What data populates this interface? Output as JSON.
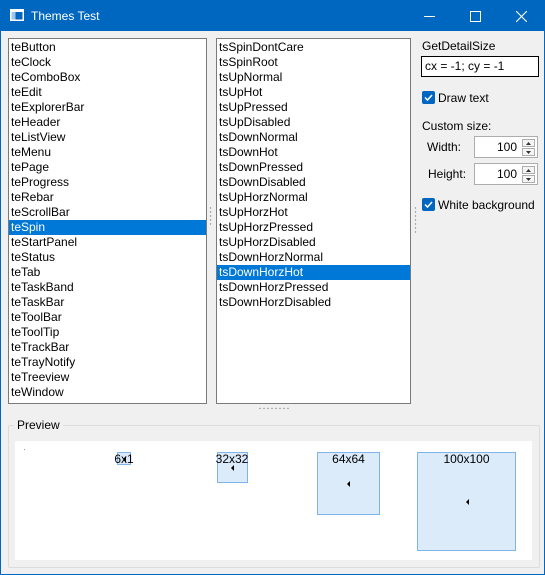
{
  "window": {
    "title": "Themes Test"
  },
  "classes": {
    "items": [
      "teButton",
      "teClock",
      "teComboBox",
      "teEdit",
      "teExplorerBar",
      "teHeader",
      "teListView",
      "teMenu",
      "tePage",
      "teProgress",
      "teRebar",
      "teScrollBar",
      "teSpin",
      "teStartPanel",
      "teStatus",
      "teTab",
      "teTaskBand",
      "teTaskBar",
      "teToolBar",
      "teToolTip",
      "teTrackBar",
      "teTrayNotify",
      "teTreeview",
      "teWindow"
    ],
    "selected": "teSpin"
  },
  "states": {
    "items": [
      "tsSpinDontCare",
      "tsSpinRoot",
      "tsUpNormal",
      "tsUpHot",
      "tsUpPressed",
      "tsUpDisabled",
      "tsDownNormal",
      "tsDownHot",
      "tsDownPressed",
      "tsDownDisabled",
      "tsUpHorzNormal",
      "tsUpHorzHot",
      "tsUpHorzPressed",
      "tsUpHorzDisabled",
      "tsDownHorzNormal",
      "tsDownHorzHot",
      "tsDownHorzPressed",
      "tsDownHorzDisabled"
    ],
    "selected": "tsDownHorzHot"
  },
  "options": {
    "detail_label": "GetDetailSize",
    "detail_value": "cx = -1; cy = -1",
    "draw_text_label": "Draw text",
    "draw_text_checked": true,
    "custom_size_label": "Custom size:",
    "width_label": "Width:",
    "width_value": "100",
    "height_label": "Height:",
    "height_value": "100",
    "white_bg_label": "White background",
    "white_bg_checked": true
  },
  "preview": {
    "title": "Preview",
    "boxes": [
      {
        "label": "6x1"
      },
      {
        "label": "32x32"
      },
      {
        "label": "64x64"
      },
      {
        "label": "100x100"
      }
    ]
  },
  "colors": {
    "accent": "#0067c0",
    "selection": "#0078d7",
    "preview_fill": "#dcebfa",
    "preview_border": "#7eb4ea"
  }
}
